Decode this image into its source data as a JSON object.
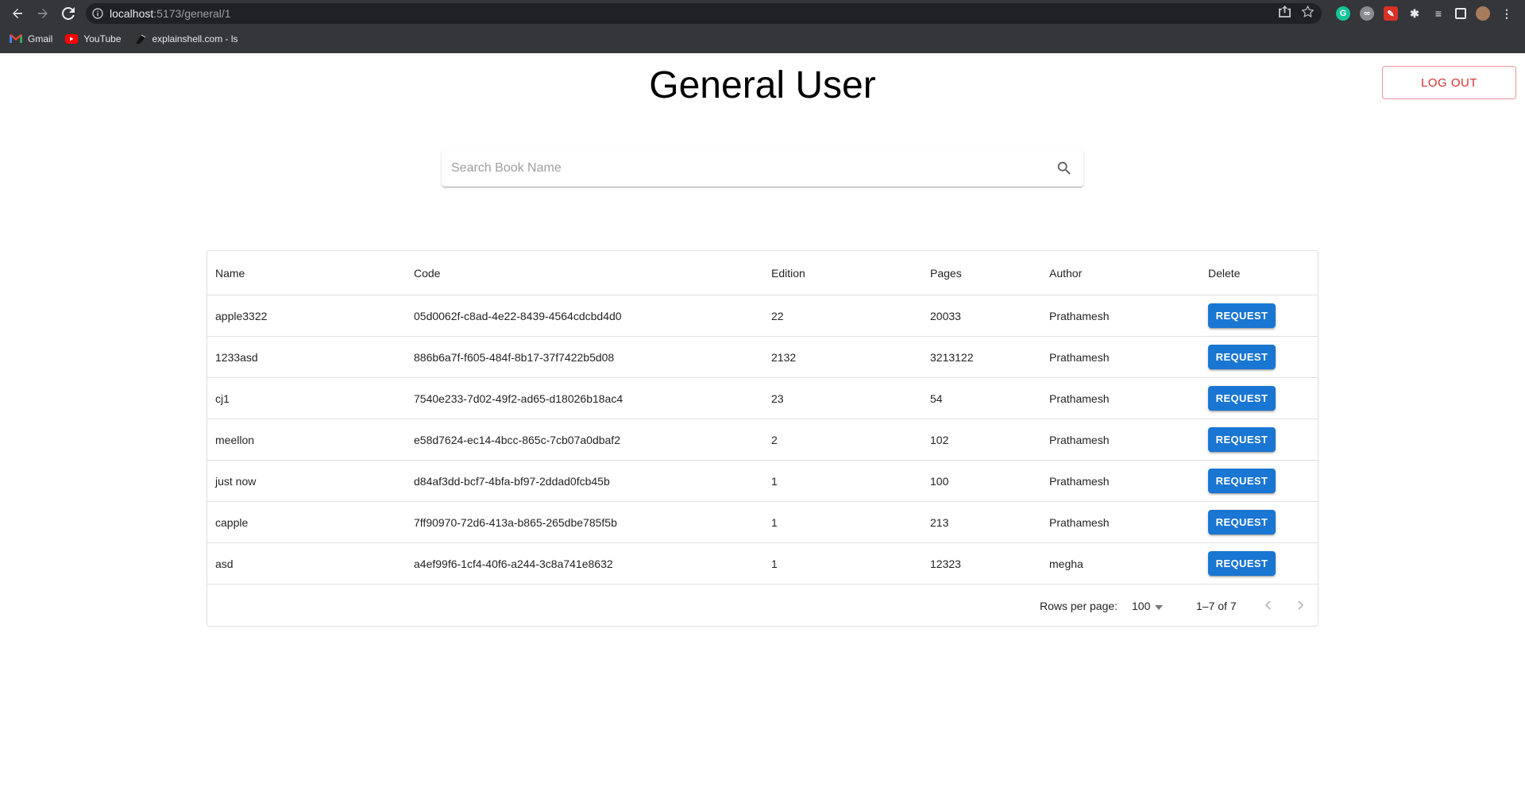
{
  "browser": {
    "url_host": "localhost",
    "url_path": ":5173/general/1",
    "bookmarks": [
      {
        "label": "Gmail",
        "icon": "gmail-icon"
      },
      {
        "label": "YouTube",
        "icon": "youtube-icon"
      },
      {
        "label": "explainshell.com - ls",
        "icon": "explainshell-icon"
      }
    ]
  },
  "page": {
    "title": "General User",
    "logout_label": "LOG OUT"
  },
  "search": {
    "placeholder": "Search Book Name",
    "value": ""
  },
  "table": {
    "columns": [
      "Name",
      "Code",
      "Edition",
      "Pages",
      "Author",
      "Delete"
    ],
    "action_label": "REQUEST",
    "rows": [
      {
        "name": "apple3322",
        "code": "05d0062f-c8ad-4e22-8439-4564cdcbd4d0",
        "edition": "22",
        "pages": "20033",
        "author": "Prathamesh"
      },
      {
        "name": "1233asd",
        "code": "886b6a7f-f605-484f-8b17-37f7422b5d08",
        "edition": "2132",
        "pages": "3213122",
        "author": "Prathamesh"
      },
      {
        "name": "cj1",
        "code": "7540e233-7d02-49f2-ad65-d18026b18ac4",
        "edition": "23",
        "pages": "54",
        "author": "Prathamesh"
      },
      {
        "name": "meellon",
        "code": "e58d7624-ec14-4bcc-865c-7cb07a0dbaf2",
        "edition": "2",
        "pages": "102",
        "author": "Prathamesh"
      },
      {
        "name": "just now",
        "code": "d84af3dd-bcf7-4bfa-bf97-2ddad0fcb45b",
        "edition": "1",
        "pages": "100",
        "author": "Prathamesh"
      },
      {
        "name": "capple",
        "code": "7ff90970-72d6-413a-b865-265dbe785f5b",
        "edition": "1",
        "pages": "213",
        "author": "Prathamesh"
      },
      {
        "name": "asd",
        "code": "a4ef99f6-1cf4-40f6-a244-3c8a741e8632",
        "edition": "1",
        "pages": "12323",
        "author": "megha"
      }
    ],
    "pagination": {
      "rows_per_page_label": "Rows per page:",
      "rows_per_page_value": "100",
      "range_label": "1–7 of 7"
    }
  },
  "colors": {
    "primary": "#1976d2",
    "error": "#d32f2f",
    "chrome_bg": "#35363a"
  }
}
